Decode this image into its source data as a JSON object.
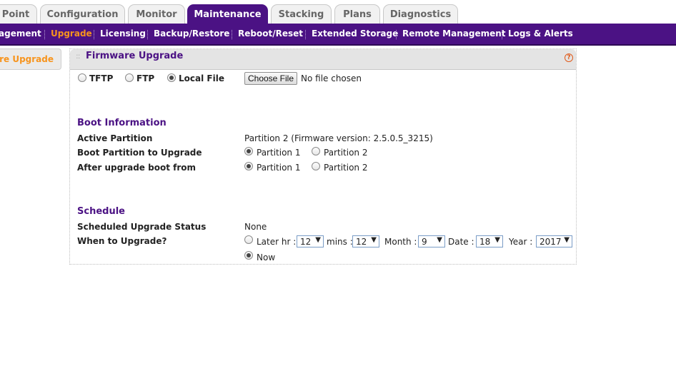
{
  "tabs": [
    {
      "label": "Point"
    },
    {
      "label": "Configuration"
    },
    {
      "label": "Monitor"
    },
    {
      "label": "Maintenance"
    },
    {
      "label": "Stacking"
    },
    {
      "label": "Plans"
    },
    {
      "label": "Diagnostics"
    }
  ],
  "active_tab": "Maintenance",
  "subnav": [
    {
      "label": "agement"
    },
    {
      "label": "Upgrade"
    },
    {
      "label": "Licensing"
    },
    {
      "label": "Backup/Restore"
    },
    {
      "label": "Reboot/Reset"
    },
    {
      "label": "Extended Storage"
    },
    {
      "label": "Remote Management"
    },
    {
      "label": "Logs & Alerts"
    }
  ],
  "active_subnav": "Upgrade",
  "leftnav": {
    "label": "are Upgrade"
  },
  "panel": {
    "title": "Firmware Upgrade",
    "help": "?",
    "source": {
      "options": [
        "TFTP",
        "FTP",
        "Local File"
      ],
      "selected": "Local File"
    },
    "file": {
      "button": "Choose File",
      "status": "No file chosen"
    },
    "boot": {
      "title": "Boot Information",
      "active_partition_label": "Active Partition",
      "active_partition_value": "Partition 2 (Firmware version: 2.5.0.5_3215)",
      "boot_partition_label": "Boot Partition to Upgrade",
      "boot_partition_options": [
        "Partition 1",
        "Partition 2"
      ],
      "boot_partition_selected": "Partition 1",
      "after_upgrade_label": "After upgrade boot from",
      "after_upgrade_options": [
        "Partition 1",
        "Partition 2"
      ],
      "after_upgrade_selected": "Partition 1"
    },
    "schedule": {
      "title": "Schedule",
      "status_label": "Scheduled Upgrade Status",
      "status_value": "None",
      "when_label": "When to Upgrade?",
      "later_label": "Later hr :",
      "hr_value": "12",
      "mins_label": "mins :",
      "mins_value": "12",
      "month_label": "Month :",
      "month_value": "9",
      "date_label": "Date :",
      "date_value": "18",
      "year_label": "Year :",
      "year_value": "2017",
      "now_label": "Now",
      "selected": "Now"
    }
  },
  "colors": {
    "brand": "#4b1284",
    "accent": "#f7941d",
    "help": "#e05a1a"
  }
}
